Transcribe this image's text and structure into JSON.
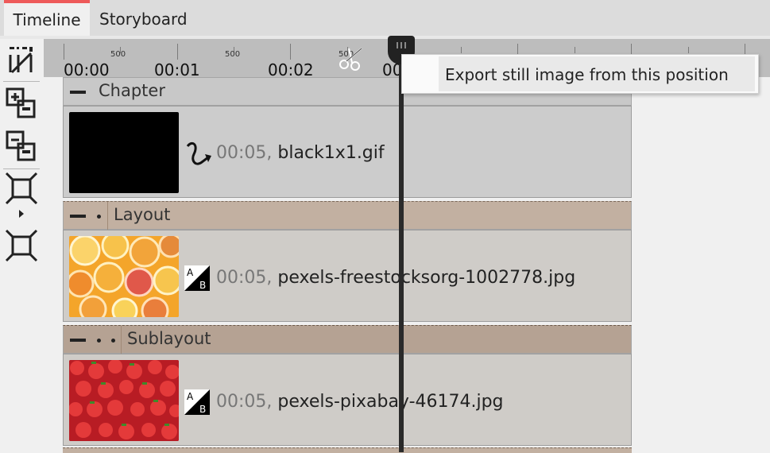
{
  "tabs": [
    {
      "label": "Timeline",
      "active": true
    },
    {
      "label": "Storyboard",
      "active": false
    }
  ],
  "ruler": {
    "times": [
      "00:00",
      "00:01",
      "00:02",
      "00"
    ],
    "ms_labels": [
      "500",
      "500",
      "500"
    ]
  },
  "tools": [
    "trim-icon",
    "add-track-icon",
    "remove-track-icon",
    "collapse-view-icon",
    "expand-view-icon"
  ],
  "context_menu": {
    "item": "Export still image from this position"
  },
  "tracks": [
    {
      "header": "Chapter",
      "duration": "00:05,",
      "filename": "black1x1.gif",
      "effect_icon": "curve-arrow-icon"
    },
    {
      "header": "Layout",
      "duration": "00:05,",
      "filename": "pexels-freestocksorg-1002778.jpg",
      "effect_icon": "ab-transition-icon"
    },
    {
      "header": "Sublayout",
      "duration": "00:05,",
      "filename": "pexels-pixabay-46174.jpg",
      "effect_icon": "ab-transition-icon"
    }
  ],
  "colors": {
    "tab_accent": "#ee5a5a",
    "layout_header": "#c2b0a1",
    "sublayout_header": "#b5a293",
    "track_bg": "#cfccc8"
  }
}
